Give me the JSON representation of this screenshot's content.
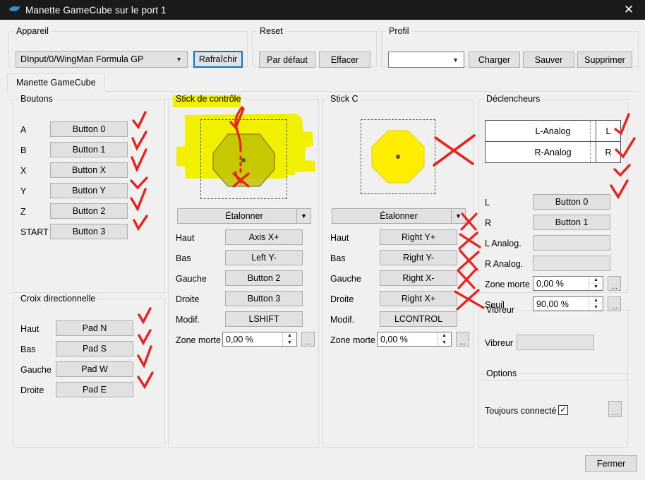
{
  "window": {
    "title": "Manette GameCube sur le port 1",
    "icon": "dolphin-icon",
    "close_label": "✕"
  },
  "device_group": {
    "legend": "Appareil",
    "selected_device": "DInput/0/WingMan Formula GP",
    "refresh_label": "Rafraîchir"
  },
  "reset_group": {
    "legend": "Reset",
    "default_label": "Par défaut",
    "clear_label": "Effacer"
  },
  "profile_group": {
    "legend": "Profil",
    "selected_profile": "",
    "load_label": "Charger",
    "save_label": "Sauver",
    "delete_label": "Supprimer"
  },
  "tabs": [
    {
      "label": "Manette GameCube",
      "active": true
    }
  ],
  "buttons_group": {
    "legend": "Boutons",
    "rows": [
      {
        "label": "A",
        "value": "Button 0"
      },
      {
        "label": "B",
        "value": "Button 1"
      },
      {
        "label": "X",
        "value": "Button X"
      },
      {
        "label": "Y",
        "value": "Button Y"
      },
      {
        "label": "Z",
        "value": "Button 2"
      },
      {
        "label": "START",
        "value": "Button 3"
      }
    ]
  },
  "dpad_group": {
    "legend": "Croix directionnelle",
    "rows": [
      {
        "label": "Haut",
        "value": "Pad N"
      },
      {
        "label": "Bas",
        "value": "Pad S"
      },
      {
        "label": "Gauche",
        "value": "Pad W"
      },
      {
        "label": "Droite",
        "value": "Pad E"
      }
    ]
  },
  "control_stick_group": {
    "legend": "Stick de contrôle",
    "calibrate_label": "Étalonner",
    "rows": [
      {
        "label": "Haut",
        "value": "Axis X+"
      },
      {
        "label": "Bas",
        "value": "Left Y-"
      },
      {
        "label": "Gauche",
        "value": "Button 2"
      },
      {
        "label": "Droite",
        "value": "Button 3"
      },
      {
        "label": "Modif.",
        "value": "LSHIFT"
      }
    ],
    "deadzone_label": "Zone morte",
    "deadzone_value": "0,00 %",
    "more_label": "..."
  },
  "c_stick_group": {
    "legend": "Stick C",
    "calibrate_label": "Étalonner",
    "rows": [
      {
        "label": "Haut",
        "value": "Right Y+"
      },
      {
        "label": "Bas",
        "value": "Right Y-"
      },
      {
        "label": "Gauche",
        "value": "Right X-"
      },
      {
        "label": "Droite",
        "value": "Right X+"
      },
      {
        "label": "Modif.",
        "value": "LCONTROL"
      }
    ],
    "deadzone_label": "Zone morte",
    "deadzone_value": "0,00 %",
    "more_label": "..."
  },
  "triggers_group": {
    "legend": "Déclencheurs",
    "bars": [
      {
        "name": "L-Analog",
        "side": "L"
      },
      {
        "name": "R-Analog",
        "side": "R"
      }
    ],
    "rows": [
      {
        "label": "L",
        "value": "Button 0"
      },
      {
        "label": "R",
        "value": "Button 1"
      }
    ],
    "analog_rows": [
      {
        "label": "L Analog.",
        "value": ""
      },
      {
        "label": "R Analog.",
        "value": ""
      }
    ],
    "deadzone_label": "Zone morte",
    "deadzone_value": "0,00 %",
    "threshold_label": "Seuil",
    "threshold_value": "90,00 %",
    "more_label": "..."
  },
  "rumble_group": {
    "legend": "Vibreur",
    "row_label": "Vibreur",
    "row_value": ""
  },
  "options_group": {
    "legend": "Options",
    "always_connected_label": "Toujours connecté",
    "always_connected_checked": true,
    "check_glyph": "✓",
    "more_label": "..."
  },
  "footer": {
    "close_label": "Fermer"
  },
  "colors": {
    "titlebar_bg": "#1a1a1a",
    "accent": "#0078d7",
    "highlighter": "#ffff00",
    "ink": "#e8231f",
    "octagon_fill_c": "#ffee00",
    "octagon_stroke": "#5a5a20"
  },
  "annotations": {
    "highlighter_note": "yellow highlighter over Stick de contrôle legend and stick preview",
    "ink_note": "red pen check marks next to mapped buttons; red X marks next to Stick C rows"
  }
}
